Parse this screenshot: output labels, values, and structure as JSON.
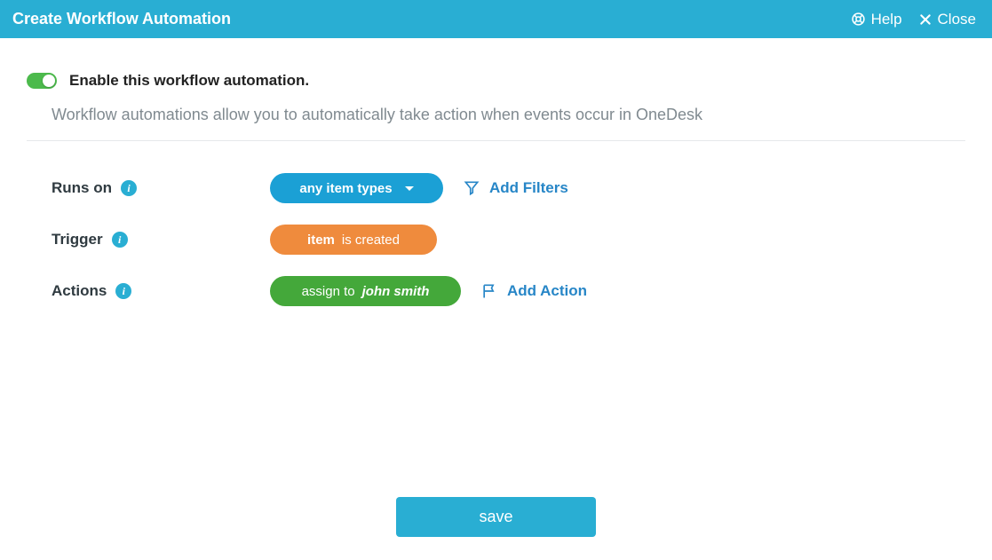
{
  "header": {
    "title": "Create Workflow Automation",
    "help_label": "Help",
    "close_label": "Close"
  },
  "enable": {
    "label": "Enable this workflow automation.",
    "on": true
  },
  "subtitle": "Workflow automations allow you to automatically take action when events occur in OneDesk",
  "rows": {
    "runs_on": {
      "label": "Runs on",
      "pill_text": "any item types",
      "add_filters_label": "Add Filters"
    },
    "trigger": {
      "label": "Trigger",
      "pill_bold": "item",
      "pill_rest": "is created"
    },
    "actions": {
      "label": "Actions",
      "pill_prefix": "assign to",
      "pill_target": "john smith",
      "add_action_label": "Add Action"
    }
  },
  "footer": {
    "save_label": "save"
  },
  "colors": {
    "brand": "#29aed3",
    "orange": "#ef8b3d",
    "green": "#44a83a",
    "link": "#2786c7"
  }
}
